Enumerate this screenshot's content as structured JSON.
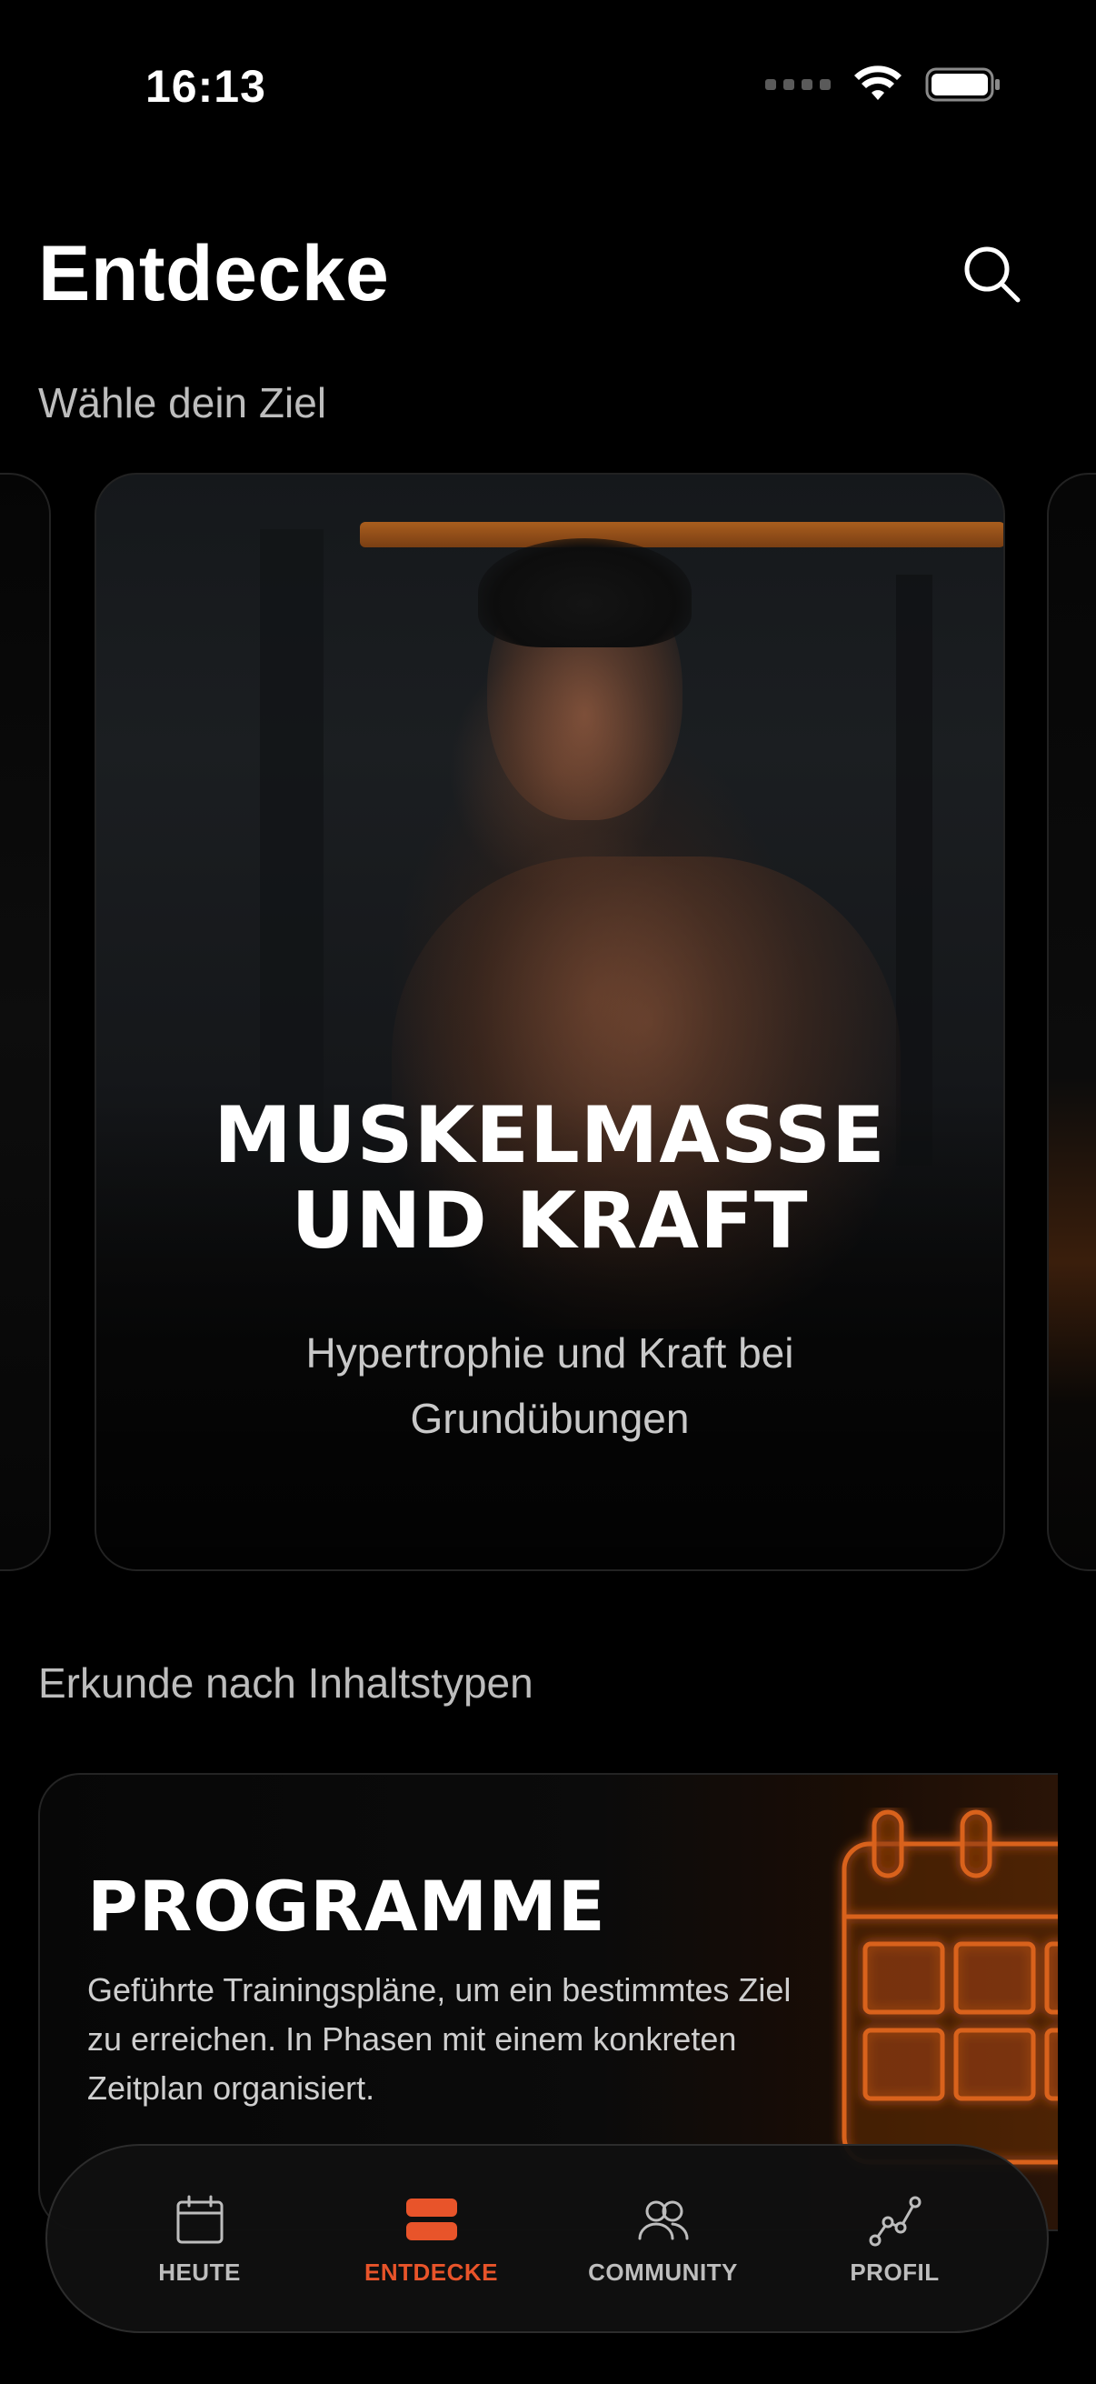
{
  "status_bar": {
    "time": "16:13"
  },
  "header": {
    "title": "Entdecke"
  },
  "goal_section": {
    "label": "Wähle dein Ziel"
  },
  "goal_card": {
    "title": "MUSKELMASSE UND KRAFT",
    "subtitle": "Hypertrophie und Kraft bei Grundübungen"
  },
  "content_section": {
    "label": "Erkunde nach Inhaltstypen"
  },
  "content_card": {
    "title": "PROGRAMME",
    "description": "Geführte Trainingspläne, um ein bestimmtes Ziel zu erreichen. In Phasen mit einem konkreten Zeitplan organisiert."
  },
  "bottom_nav": {
    "items": [
      {
        "label": "HEUTE",
        "icon": "calendar-icon",
        "active": false
      },
      {
        "label": "ENTDECKE",
        "icon": "discover-icon",
        "active": true
      },
      {
        "label": "COMMUNITY",
        "icon": "people-icon",
        "active": false
      },
      {
        "label": "PROFIL",
        "icon": "chart-icon",
        "active": false
      }
    ]
  },
  "colors": {
    "accent": "#e8542a",
    "background": "#000000",
    "muted_text": "#bdbdbd"
  }
}
